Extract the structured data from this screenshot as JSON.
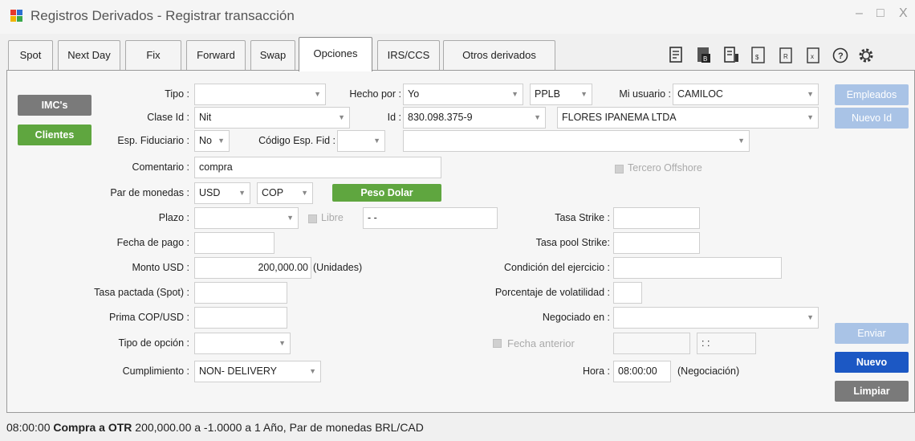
{
  "window": {
    "title": "Registros Derivados - Registrar transacción",
    "controls": [
      "–",
      "□",
      "X"
    ]
  },
  "tabs": [
    "Spot",
    "Next Day",
    "Fix",
    "Forward",
    "Swap",
    "Opciones",
    "IRS/CCS",
    "Otros derivados"
  ],
  "toolbar_icons": [
    "document-list-icon",
    "pdf-icon",
    "report-icon",
    "spreadsheet-icon",
    "file-r-icon",
    "file-x-icon",
    "help-icon",
    "gear-icon"
  ],
  "buttons": {
    "imcs": "IMC's",
    "clientes": "Clientes",
    "peso_dolar": "Peso Dolar",
    "empleados": "Empleados",
    "nuevo_id": "Nuevo Id",
    "enviar": "Enviar",
    "nuevo": "Nuevo",
    "limpiar": "Limpiar"
  },
  "labels": {
    "tipo": "Tipo :",
    "hecho_por": "Hecho por :",
    "mi_usuario": "Mi usuario :",
    "clase_id": "Clase Id :",
    "id": "Id :",
    "esp_fiduciario": "Esp. Fiduciario :",
    "codigo_esp_fid": "Código Esp. Fid :",
    "comentario": "Comentario :",
    "tercero_offshore": "Tercero Offshore",
    "par_monedas": "Par de monedas :",
    "plazo": "Plazo :",
    "libre": "Libre",
    "tasa_strike": "Tasa Strike :",
    "fecha_pago": "Fecha de pago :",
    "tasa_pool_strike": "Tasa pool Strike:",
    "monto_usd": "Monto USD :",
    "unidades": "(Unidades)",
    "condicion_ejercicio": "Condición del ejercicio :",
    "tasa_pactada": "Tasa pactada (Spot) :",
    "porcentaje_volatilidad": "Porcentaje de volatilidad :",
    "prima": "Prima COP/USD :",
    "negociado_en": "Negociado en :",
    "tipo_opcion": "Tipo de opción :",
    "fecha_anterior": "Fecha anterior",
    "cumplimiento": "Cumplimiento :",
    "hora": "Hora :",
    "negociacion": "(Negociación)"
  },
  "values": {
    "tipo": "",
    "hecho_por": "Yo",
    "pplb": "PPLB",
    "mi_usuario": "CAMILOC",
    "clase_id": "Nit",
    "id": "830.098.375-9",
    "razon_social": "FLORES IPANEMA LTDA",
    "esp_fiduciario": "No",
    "codigo_esp_fid": "",
    "codigo_desc": "",
    "comentario": "compra",
    "moneda1": "USD",
    "moneda2": "COP",
    "plazo": "",
    "libre_fecha": "-  -",
    "tasa_strike": "",
    "fecha_pago": "",
    "tasa_pool_strike": "",
    "monto_usd": "200,000.00",
    "condicion_ejercicio": "",
    "tasa_pactada": "",
    "porcentaje_volatilidad": "",
    "prima": "",
    "negociado_en": "",
    "tipo_opcion": "",
    "fecha_anterior": "",
    "fecha_anterior_hora": ": :",
    "cumplimiento": "NON- DELIVERY",
    "hora": "08:00:00"
  },
  "status": {
    "time": "08:00:00",
    "bold": "Compra a OTR",
    "rest": "200,000.00 a -1.0000 a 1 Año, Par de monedas BRL/CAD"
  },
  "colors": {
    "green": "#5fa63f",
    "blue": "#1c58c4",
    "lightblue": "#a9c3e6",
    "gray": "#7a7a7a"
  }
}
